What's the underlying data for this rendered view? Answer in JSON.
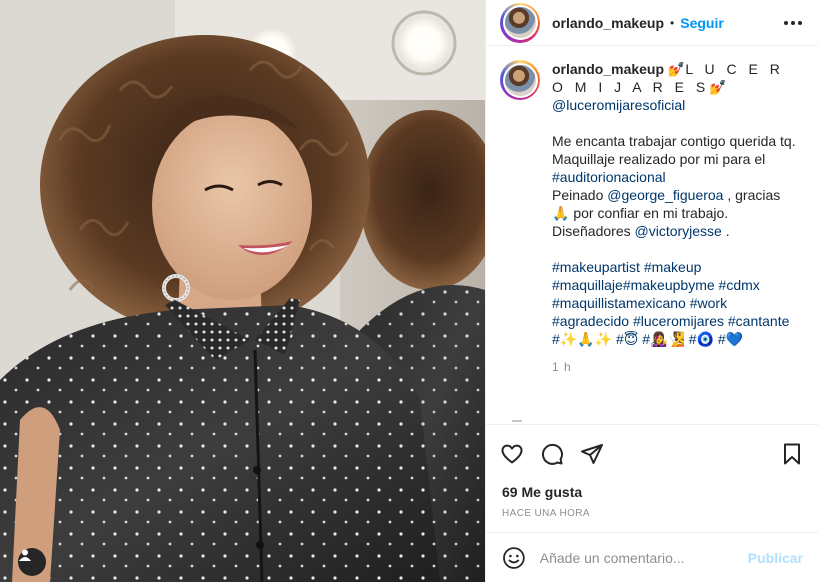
{
  "photo": {
    "description_icon": "person-tag-icon"
  },
  "header": {
    "username": "orlando_makeup",
    "separator": "•",
    "follow_label": "Seguir",
    "more_icon": "more-options-icon"
  },
  "caption": {
    "username": "orlando_makeup",
    "title_prefix_emoji": "💅",
    "title": "L U C E R O M I J A R E S",
    "title_suffix_emoji": "💅",
    "mention_1": "@luceromijaresoficial",
    "line_1": "Me encanta trabajar contigo querida tq.",
    "line_2": "Maquillaje realizado por mi para el",
    "hashtag_auditorio": "#auditorionacional",
    "peinado_label": "Peinado",
    "mention_george": "@george_figueroa",
    "gracias_text": ", gracias",
    "gracias_emoji": "🙏",
    "confiar_text": "por confiar en mi trabajo.",
    "disenadores_label": "Diseñadores",
    "mention_victory": "@victoryjesse",
    "disenadores_end": ".",
    "hashtags_line_1": "#makeupartist #makeup",
    "hashtags_line_2": "#maquillaje#makeupbyme #cdmx",
    "hashtags_line_3": "#maquillistamexicano #work",
    "hashtags_line_4": "#agradecido #luceromijares #cantante",
    "hashtags_line_5": "#✨🙏✨ #😇 #👩‍🎤🧏 #🧿 #💙",
    "time": "1 h"
  },
  "actions": {
    "like_icon": "heart-icon",
    "comment_icon": "comment-icon",
    "share_icon": "share-icon",
    "save_icon": "bookmark-icon"
  },
  "likes_label": "69 Me gusta",
  "posted_ago": "HACE UNA HORA",
  "comment_box": {
    "placeholder": "Añade un comentario...",
    "publish_label": "Publicar",
    "emoji_icon": "emoji-icon"
  },
  "colors": {
    "link": "#00376b",
    "follow": "#0095f6",
    "publish_disabled": "#b2dffc",
    "muted": "#8e8e8e"
  }
}
